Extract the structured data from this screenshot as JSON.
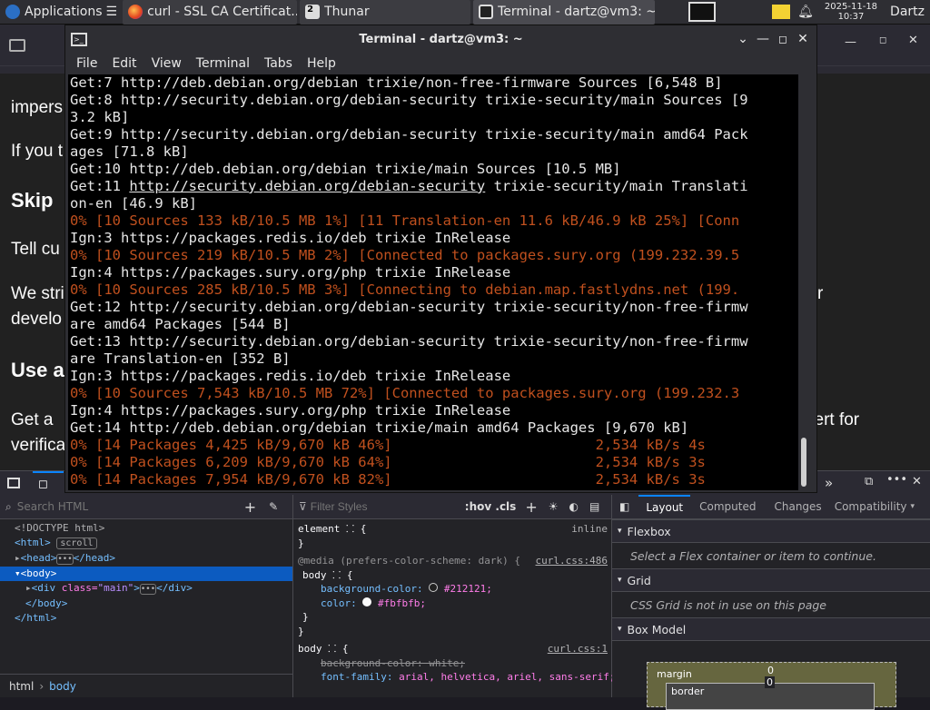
{
  "panel": {
    "applications_label": "Applications",
    "tasks": [
      {
        "label": "curl - SSL CA Certificat...",
        "icon": "firefox-icon"
      },
      {
        "label": "Thunar",
        "icon": "thunar-icon",
        "badge": "2"
      },
      {
        "label": "Terminal - dartz@vm3: ~",
        "icon": "terminal-icon"
      }
    ],
    "clock_date": "2025-11-18",
    "clock_time": "10:37",
    "user": "Dartz"
  },
  "terminal": {
    "title": "Terminal - dartz@vm3: ~",
    "menu": [
      "File",
      "Edit",
      "View",
      "Terminal",
      "Tabs",
      "Help"
    ],
    "lines": [
      {
        "t": "Get:7 http://deb.debian.org/debian trixie/non-free-firmware Sources [6,548 B]",
        "k": "n"
      },
      {
        "t": "Get:8 http://security.debian.org/debian-security trixie-security/main Sources [9",
        "k": "n"
      },
      {
        "t": "3.2 kB]",
        "k": "n"
      },
      {
        "t": "Get:9 http://security.debian.org/debian-security trixie-security/main amd64 Pack",
        "k": "n"
      },
      {
        "t": "ages [71.8 kB]",
        "k": "n"
      },
      {
        "t": "Get:10 http://deb.debian.org/debian trixie/main Sources [10.5 MB]",
        "k": "n"
      },
      {
        "t": "Get:11 http://security.debian.org/debian-security trixie-security/main Translati",
        "k": "n",
        "link": "http://security.debian.org/debian-security"
      },
      {
        "t": "on-en [46.9 kB]",
        "k": "n"
      },
      {
        "t": "0% [10 Sources 133 kB/10.5 MB 1%] [11 Translation-en 11.6 kB/46.9 kB 25%] [Conn",
        "k": "p"
      },
      {
        "t": "Ign:3 https://packages.redis.io/deb trixie InRelease",
        "k": "n"
      },
      {
        "t": "0% [10 Sources 219 kB/10.5 MB 2%] [Connected to packages.sury.org (199.232.39.5",
        "k": "p"
      },
      {
        "t": "Ign:4 https://packages.sury.org/php trixie InRelease",
        "k": "n"
      },
      {
        "t": "0% [10 Sources 285 kB/10.5 MB 3%] [Connecting to debian.map.fastlydns.net (199.",
        "k": "p"
      },
      {
        "t": "Get:12 http://security.debian.org/debian-security trixie-security/non-free-firmw",
        "k": "n"
      },
      {
        "t": "are amd64 Packages [544 B]",
        "k": "n"
      },
      {
        "t": "Get:13 http://security.debian.org/debian-security trixie-security/non-free-firmw",
        "k": "n"
      },
      {
        "t": "are Translation-en [352 B]",
        "k": "n"
      },
      {
        "t": "Ign:3 https://packages.redis.io/deb trixie InRelease",
        "k": "n"
      },
      {
        "t": "0% [10 Sources 7,543 kB/10.5 MB 72%] [Connected to packages.sury.org (199.232.3",
        "k": "p"
      },
      {
        "t": "Ign:4 https://packages.sury.org/php trixie InRelease",
        "k": "n"
      },
      {
        "t": "Get:14 http://deb.debian.org/debian trixie/main amd64 Packages [9,670 kB]",
        "k": "n"
      },
      {
        "t": "0% [14 Packages 4,425 kB/9,670 kB 46%]                        2,534 kB/s 4s",
        "k": "p"
      },
      {
        "t": "0% [14 Packages 6,209 kB/9,670 kB 64%]                        2,534 kB/s 3s",
        "k": "p"
      },
      {
        "t": "0% [14 Packages 7,954 kB/9,670 kB 82%]                        2,534 kB/s 3s",
        "k": "p"
      }
    ]
  },
  "page": {
    "fragments": [
      "impers",
      "If you t",
      "Skip",
      "Tell cu",
      "We stri",
      "develo",
      "Use a",
      "Get a",
      "verifica"
    ],
    "right_fragments": [
      "r",
      "cert for"
    ]
  },
  "devtools": {
    "search_placeholder": "Search HTML",
    "filter_placeholder": "Filter Styles",
    "hov_cls": ":hov .cls",
    "layout_tabs": [
      "Layout",
      "Computed",
      "Changes",
      "Compatibility"
    ],
    "tree": {
      "doctype": "<!DOCTYPE html>",
      "html_tag": "<html>",
      "html_badge": "scroll",
      "head": "<head>",
      "head_close": "</head>",
      "body": "<body>",
      "div_open": "<div",
      "div_attr": "class=",
      "div_val": "\"main\"",
      "div_close": "</div>",
      "body_close": "</body>",
      "html_close": "</html>"
    },
    "rules": {
      "element": "element",
      "inline": "inline",
      "media": "@media (prefers-color-scheme: dark) {",
      "media_src": "curl.css:486",
      "body_sel": "body",
      "bg_prop": "background-color:",
      "bg_val": "#212121;",
      "color_prop": "color:",
      "color_val": "#fbfbfb;",
      "rule2_src": "curl.css:1",
      "strike_prop": "background-color: white;",
      "font_prop": "font-family:",
      "font_val": "arial, helvetica, ariel, sans-serif;"
    },
    "sections": {
      "flexbox": "Flexbox",
      "flexbox_msg": "Select a Flex container or item to continue.",
      "grid": "Grid",
      "grid_msg": "CSS Grid is not in use on this page",
      "boxmodel": "Box Model",
      "margin": "margin",
      "margin_val": "0",
      "border": "border",
      "border_val": "0"
    },
    "breadcrumb": [
      "html",
      "body"
    ]
  },
  "colors": {
    "terminal_bg": "#000000",
    "progress_text": "#c0501e",
    "devtools_selection": "#0c5bc0",
    "page_bg": "#212121"
  }
}
